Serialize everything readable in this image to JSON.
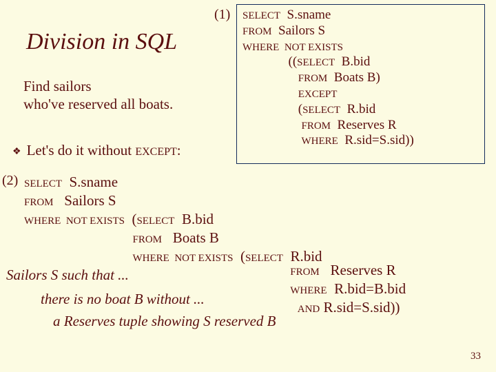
{
  "title": "Division in SQL",
  "subtitle_line1": "Find sailors",
  "subtitle_line2": "who've reserved all boats.",
  "bullet": {
    "symbol": "❖",
    "text_prefix": "Let's do it without ",
    "except_kw": "EXCEPT",
    "text_suffix": ":"
  },
  "label1": "(1)",
  "label2": "(2)",
  "query1": {
    "l1_kw": "SELECT",
    "l1_rest": "  S.sname",
    "l2_kw": "FROM",
    "l2_rest": "  Sailors S",
    "l3_kw": "WHERE  NOT EXISTS",
    "l4_kw": "SELECT",
    "l4_rest": "  B.bid",
    "l5_kw": "FROM",
    "l5_rest": "  Boats B)",
    "l6_kw": "EXCEPT",
    "l7_kw": "SELECT",
    "l7_rest": "  R.bid",
    "l8_kw": "FROM",
    "l8_rest": "  Reserves R",
    "l9_kw": "WHERE",
    "l9_rest": "  R.sid=S.sid))"
  },
  "query2": {
    "l1_kw": "SELECT",
    "l1_rest": "  S.sname",
    "l2_kw": "FROM",
    "l2_rest": "   Sailors S",
    "l3_kw": "WHERE  NOT EXISTS",
    "l3_mid_kw": "SELECT",
    "l3_rest": "  B.bid",
    "l4_kw": "FROM",
    "l4_rest": "   Boats B",
    "l5_kw": "WHERE  NOT EXISTS",
    "l5_mid_kw": "SELECT",
    "l5_rest": "  R.bid",
    "l6_kw": "FROM",
    "l6_rest": "   Reserves R",
    "l7_kw": "WHERE",
    "l7_rest": "  R.bid=B.bid",
    "l8_kw": "AND",
    "l8_rest": " R.sid=S.sid))"
  },
  "explain1": "Sailors S such that ...",
  "explain2": "there is no boat B without ...",
  "explain3": "a Reserves tuple showing S reserved B",
  "slide_number": "33"
}
